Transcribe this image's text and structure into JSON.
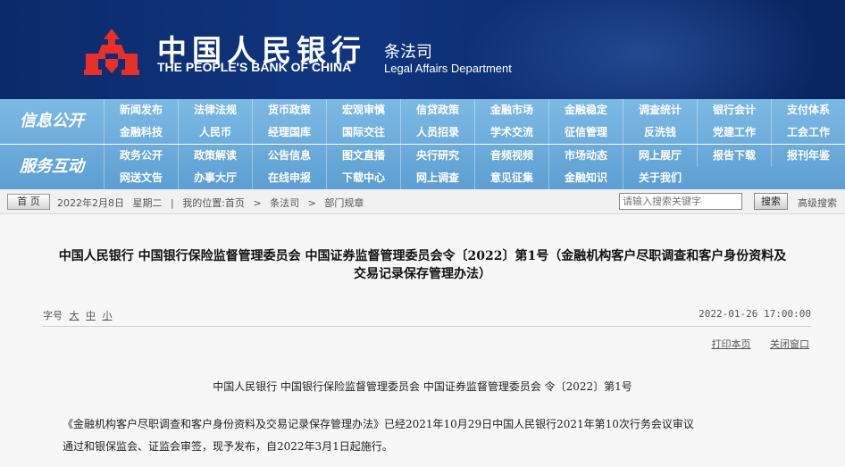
{
  "header": {
    "bank_name_cn": "中国人民银行",
    "bank_name_en": "THE PEOPLE'S BANK OF CHINA",
    "dept_cn": "条法司",
    "dept_en": "Legal Affairs Department",
    "logo_icon": "pboc-logo-icon",
    "colors": {
      "banner": "#0b2a6b",
      "logo": "#e8302a",
      "nav": "#6aa9da"
    }
  },
  "nav": {
    "info": {
      "title": "信息公开",
      "row1": [
        "新闻发布",
        "法律法规",
        "货币政策",
        "宏观审慎",
        "信贷政策",
        "金融市场",
        "金融稳定",
        "调查统计",
        "银行会计",
        "支付体系"
      ],
      "row2": [
        "金融科技",
        "人民币",
        "经理国库",
        "国际交往",
        "人员招录",
        "学术交流",
        "征信管理",
        "反洗钱",
        "党建工作",
        "工会工作"
      ]
    },
    "service": {
      "title": "服务互动",
      "row1": [
        "政务公开",
        "政策解读",
        "公告信息",
        "图文直播",
        "央行研究",
        "音频视频",
        "市场动态",
        "网上展厅",
        "报告下载",
        "报刊年鉴"
      ],
      "row2": [
        "网送文告",
        "办事大厅",
        "在线申报",
        "下载中心",
        "网上调查",
        "意见征集",
        "金融知识",
        "关于我们"
      ]
    }
  },
  "crumbbar": {
    "home_label": "首 页",
    "date": "2022年2月8日",
    "weekday": "星期二",
    "sep": "|",
    "location_label": "我的位置:首页",
    "arrow": ">",
    "crumb1": "条法司",
    "crumb2": "部门规章",
    "search_placeholder": "请输入搜索关键字",
    "search_label": "搜索",
    "adv_search_label": "高级搜索"
  },
  "article": {
    "title_line1": "中国人民银行  中国银行保险监督管理委员会  中国证券监督管理委员会令〔2022〕第1号（金融机构客户尽职调查和客户身份资料及",
    "title_line2": "交易记录保存管理办法）",
    "fontsize_label": "字号",
    "fontsize_large": "大",
    "fontsize_medium": "中",
    "fontsize_small": "小",
    "pub_date": "2022-01-26 17:00:00",
    "print_label": "打印本页",
    "close_label": "关闭窗口",
    "order_line": "中国人民银行  中国银行保险监督管理委员会  中国证券监督管理委员会    令〔2022〕第1号",
    "para_line1": "《金融机构客户尽职调查和客户身份资料及交易记录保存管理办法》已经2021年10月29日中国人民银行2021年第10次行务会议审议",
    "para_line2": "通过和银保监会、证监会审签，现予发布，自2022年3月1日起施行。"
  }
}
